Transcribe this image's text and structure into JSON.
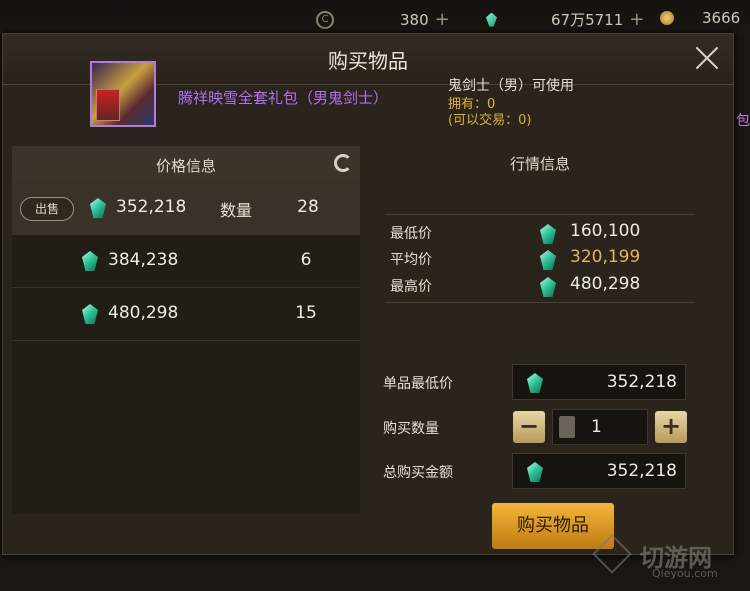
{
  "currency": {
    "c_value": "380",
    "gem_value": "67万5711",
    "gold_value": "3666"
  },
  "dialog": {
    "title": "购买物品"
  },
  "item": {
    "name": "腾祥映雪全套礼包（男鬼剑士）",
    "usable": "鬼剑士（男）可使用",
    "owned": "拥有：0",
    "tradable": "(可以交易：0)"
  },
  "price_panel": {
    "header": "价格信息",
    "sell_label": "出售",
    "qty_label": "数量",
    "rows": [
      {
        "price": "352,218",
        "qty": "28"
      },
      {
        "price": "384,238",
        "qty": "6"
      },
      {
        "price": "480,298",
        "qty": "15"
      }
    ]
  },
  "market": {
    "header": "行情信息",
    "stats": [
      {
        "label": "最低价",
        "value": "160,100"
      },
      {
        "label": "平均价",
        "value": "320,199"
      },
      {
        "label": "最高价",
        "value": "480,298"
      }
    ]
  },
  "purchase": {
    "unit_min_label": "单品最低价",
    "unit_min_value": "352,218",
    "qty_label": "购买数量",
    "qty_value": "1",
    "total_label": "总购买金额",
    "total_value": "352,218",
    "buy_label": "购买物品"
  },
  "watermark": {
    "text": "切游网",
    "sub": "Qieyou.com"
  },
  "colors": {
    "gem": "#33c79a",
    "buy_button": "#e0a030",
    "item_name": "#b070f0",
    "average_price": "#e8b060"
  }
}
